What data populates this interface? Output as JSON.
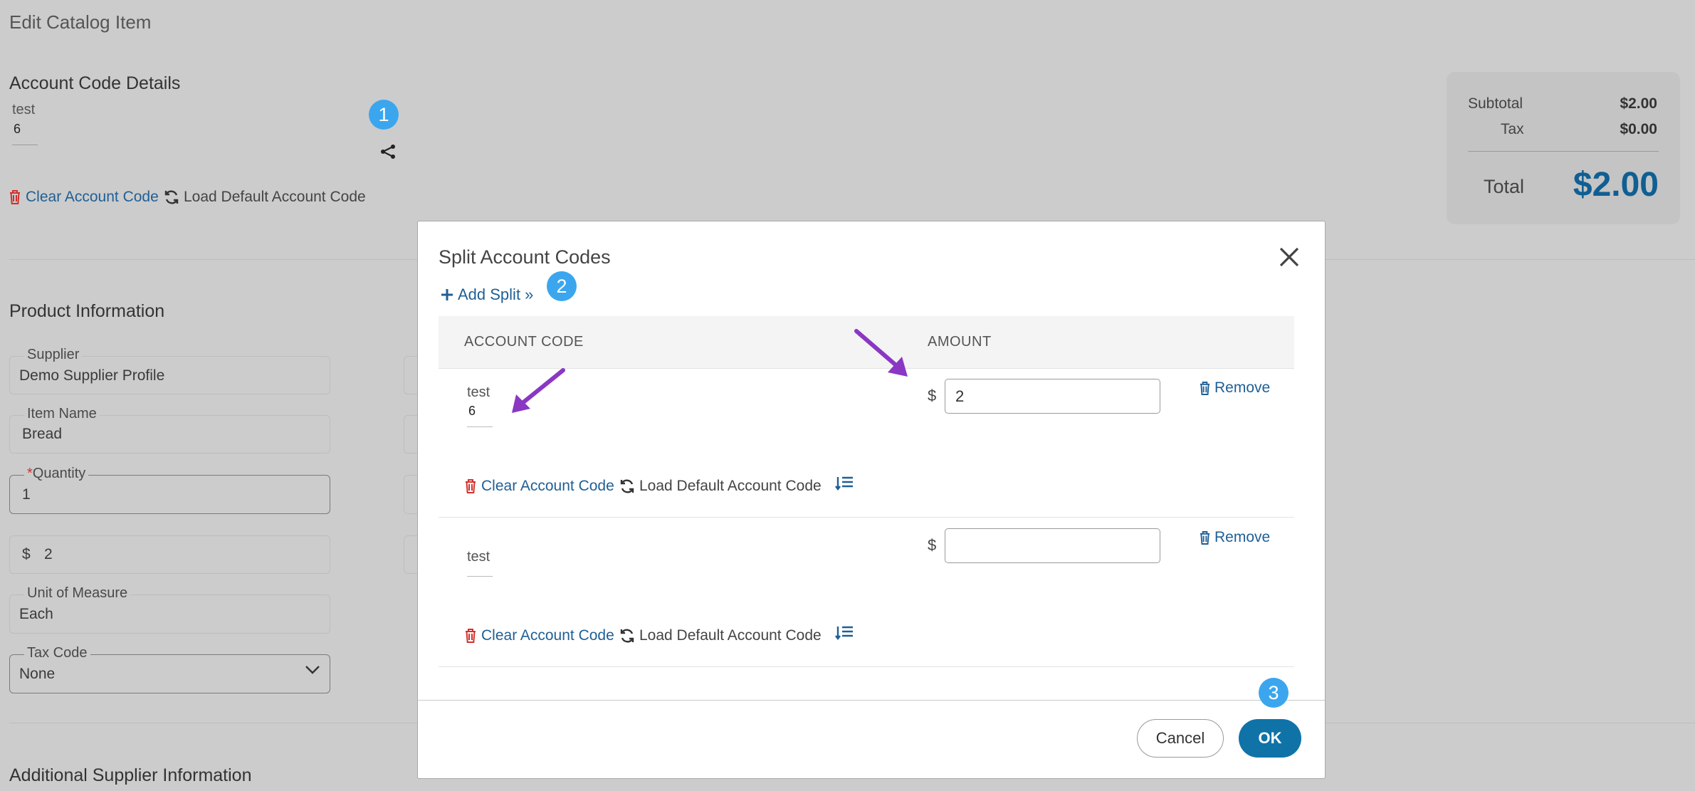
{
  "page_title": "Edit Catalog Item",
  "account_code": {
    "heading": "Account Code Details",
    "code_name": "test",
    "code_value": "6",
    "clear_label": "Clear Account Code",
    "load_default_label": "Load Default Account Code"
  },
  "summary": {
    "subtotal_label": "Subtotal",
    "subtotal_value": "$2.00",
    "tax_label": "Tax",
    "tax_value": "$0.00",
    "total_label": "Total",
    "total_value": "$2.00"
  },
  "product": {
    "heading": "Product Information",
    "supplier_label": "Supplier",
    "supplier_value": "Demo Supplier Profile",
    "item_name_label": "Item Name",
    "item_name_value": "Bread",
    "quantity_required": "*",
    "quantity_label": "Quantity",
    "quantity_value": "1",
    "price_currency": "$",
    "price_value": "2",
    "uom_label": "Unit of Measure",
    "uom_value": "Each",
    "tax_code_label": "Tax Code",
    "tax_code_value": "None"
  },
  "additional_heading": "Additional Supplier Information",
  "badges": {
    "one": "1",
    "two": "2",
    "three": "3"
  },
  "modal": {
    "title": "Split Account Codes",
    "add_split_label": "Add Split »",
    "col_account_code": "ACCOUNT CODE",
    "col_amount": "AMOUNT",
    "currency": "$",
    "remove_label": "Remove",
    "clear_label": "Clear Account Code",
    "load_default_label": "Load Default Account Code",
    "rows": [
      {
        "code_name": "test",
        "code_value": "6",
        "amount": "2"
      },
      {
        "code_name": "test",
        "code_value": "",
        "amount": ""
      }
    ],
    "cancel_label": "Cancel",
    "ok_label": "OK"
  },
  "colors": {
    "badge": "#3ba6ee",
    "ok_button": "#0f73a8",
    "arrow": "#8a37c4",
    "link": "#1f5f95",
    "trash": "#d0312d",
    "total": "#0f5f93"
  }
}
